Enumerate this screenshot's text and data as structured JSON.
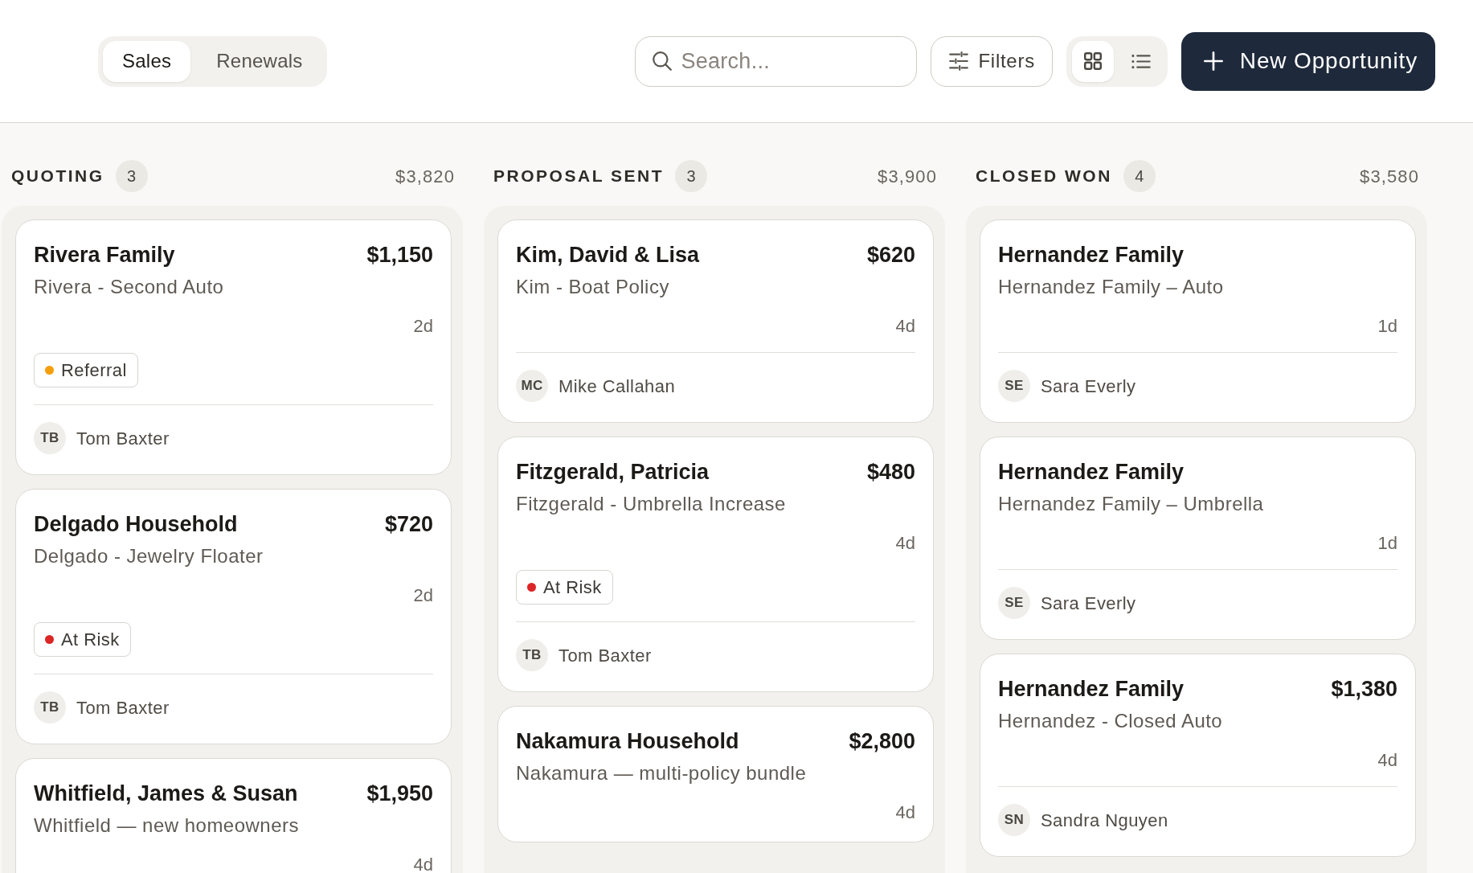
{
  "view_tabs": [
    {
      "label": "Sales",
      "selected": true
    },
    {
      "label": "Renewals",
      "selected": false
    }
  ],
  "search": {
    "placeholder": "Search..."
  },
  "filters_button": {
    "label": "Filters"
  },
  "view_toggle": [
    {
      "kind": "grid",
      "selected": true
    },
    {
      "kind": "list",
      "selected": false
    }
  ],
  "new_button": {
    "label": "New Opportunity"
  },
  "columns": [
    {
      "title": "QUOTING",
      "count": "3",
      "total": "$3,820",
      "cards": [
        {
          "name": "Rivera Family",
          "amount": "$1,150",
          "description": "Rivera - Second Auto",
          "age": "2d",
          "tag": {
            "label": "Referral",
            "color": "#f59e0b"
          },
          "owner": {
            "initials": "TB",
            "name": "Tom Baxter"
          }
        },
        {
          "name": "Delgado Household",
          "amount": "$720",
          "description": "Delgado - Jewelry Floater",
          "age": "2d",
          "tag": {
            "label": "At Risk",
            "color": "#dc2626"
          },
          "owner": {
            "initials": "TB",
            "name": "Tom Baxter"
          }
        },
        {
          "name": "Whitfield, James & Susan",
          "amount": "$1,950",
          "description": "Whitfield — new homeowners",
          "age": "4d"
        }
      ]
    },
    {
      "title": "PROPOSAL SENT",
      "count": "3",
      "total": "$3,900",
      "cards": [
        {
          "name": "Kim, David & Lisa",
          "amount": "$620",
          "description": "Kim - Boat Policy",
          "age": "4d",
          "owner": {
            "initials": "MC",
            "name": "Mike Callahan"
          }
        },
        {
          "name": "Fitzgerald, Patricia",
          "amount": "$480",
          "description": "Fitzgerald - Umbrella Increase",
          "age": "4d",
          "tag": {
            "label": "At Risk",
            "color": "#dc2626"
          },
          "owner": {
            "initials": "TB",
            "name": "Tom Baxter"
          }
        },
        {
          "name": "Nakamura Household",
          "amount": "$2,800",
          "description": "Nakamura — multi-policy bundle",
          "age": "4d"
        }
      ]
    },
    {
      "title": "CLOSED WON",
      "count": "4",
      "total": "$3,580",
      "cards": [
        {
          "name": "Hernandez Family",
          "description": "Hernandez Family – Auto",
          "age": "1d",
          "owner": {
            "initials": "SE",
            "name": "Sara Everly"
          }
        },
        {
          "name": "Hernandez Family",
          "description": "Hernandez Family – Umbrella",
          "age": "1d",
          "owner": {
            "initials": "SE",
            "name": "Sara Everly"
          }
        },
        {
          "name": "Hernandez Family",
          "amount": "$1,380",
          "description": "Hernandez - Closed Auto",
          "age": "4d",
          "owner": {
            "initials": "SN",
            "name": "Sandra Nguyen"
          }
        }
      ]
    }
  ]
}
